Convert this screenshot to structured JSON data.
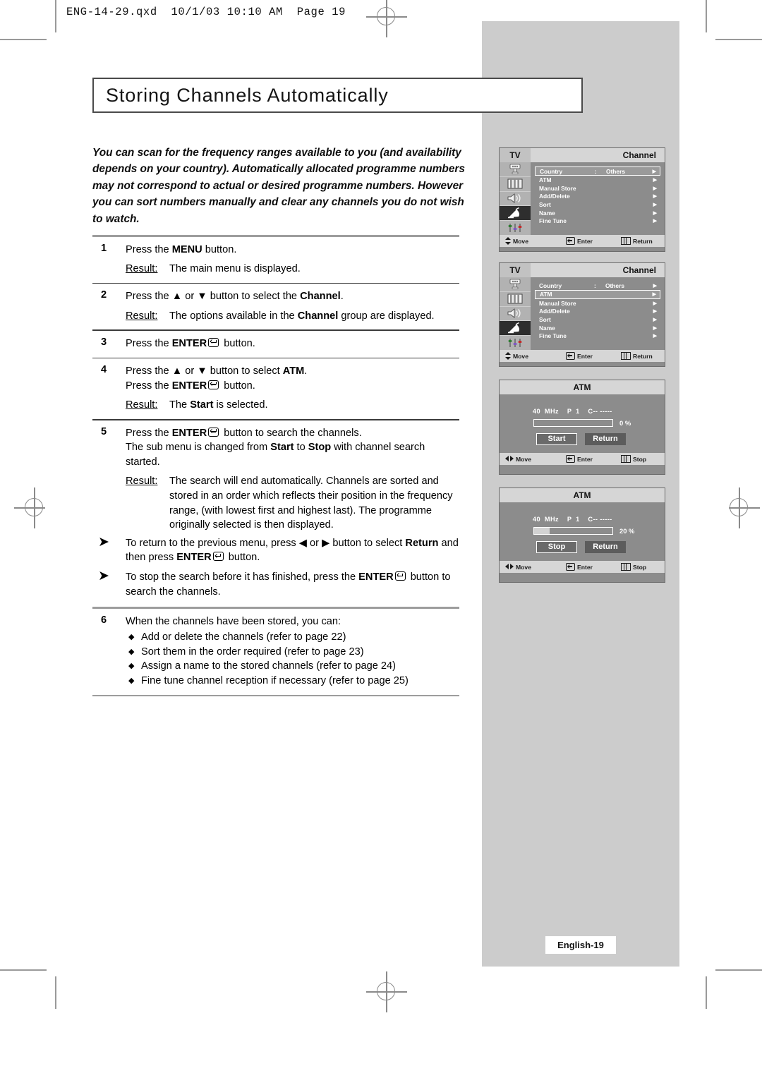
{
  "file_header": "ENG-14-29.qxd  10/1/03 10:10 AM  Page 19",
  "title": "Storing Channels Automatically",
  "intro": "You can scan for the frequency ranges available to you (and availability depends on your country). Automatically allocated programme numbers may not correspond to actual or desired programme numbers. However you can sort numbers manually and clear any channels you do not wish to watch.",
  "steps": {
    "s1": {
      "num": "1",
      "text_pre": "Press the ",
      "bold": "MENU",
      "text_post": " button.",
      "result_label": "Result:",
      "result_text": "The main menu is displayed."
    },
    "s2": {
      "num": "2",
      "text_pre": "Press the ▲ or ▼ button to select the ",
      "bold": "Channel",
      "text_post": ".",
      "result_label": "Result:",
      "result_pre": "The options available in the ",
      "result_bold": "Channel",
      "result_post": " group are displayed."
    },
    "s3": {
      "num": "3",
      "text_pre": "Press the ",
      "bold": "ENTER",
      "text_post": " button."
    },
    "s4": {
      "num": "4",
      "line1_pre": "Press the ▲ or ▼ button to select ",
      "line1_bold": "ATM",
      "line1_post": ".",
      "line2_pre": "Press the ",
      "line2_bold": "ENTER",
      "line2_post": " button.",
      "result_label": "Result:",
      "result_pre": "The ",
      "result_bold": "Start",
      "result_post": " is selected."
    },
    "s5": {
      "num": "5",
      "line1_pre": "Press the ",
      "line1_bold": "ENTER",
      "line1_post": " button to search the channels.",
      "line2_pre": "The sub menu is changed from ",
      "line2_bold1": "Start",
      "line2_mid": " to ",
      "line2_bold2": "Stop",
      "line2_post": " with channel search started.",
      "result_label": "Result:",
      "result_text": "The search will end automatically. Channels are sorted and stored in an order which reflects their position in the frequency range, (with lowest first and highest last). The programme originally selected is then displayed."
    },
    "s6": {
      "num": "6",
      "text": "When the channels have been stored, you can:",
      "bullets": [
        "Add or delete the channels (refer to page 22)",
        "Sort them in the order required (refer to page 23)",
        "Assign a name to the stored channels (refer to page 24)",
        "Fine tune channel reception if necessary (refer to page 25)"
      ]
    }
  },
  "notes": [
    {
      "pre": "To return to the previous menu, press ◀ or ▶ button to select ",
      "bold1": "Return",
      "mid": " and then press ",
      "bold2": "ENTER",
      "post": " button."
    },
    {
      "pre": "To stop the search before it has finished, press the ",
      "bold1": "ENTER",
      "post": " button to search the channels."
    }
  ],
  "osd": {
    "tv_label": "TV",
    "group_label": "Channel",
    "menu_items": [
      {
        "label": "Country",
        "colon": ":",
        "value": "Others",
        "arrow": "▶"
      },
      {
        "label": "ATM",
        "colon": "",
        "value": "",
        "arrow": "▶"
      },
      {
        "label": "Manual Store",
        "colon": "",
        "value": "",
        "arrow": "▶"
      },
      {
        "label": "Add/Delete",
        "colon": "",
        "value": "",
        "arrow": "▶"
      },
      {
        "label": "Sort",
        "colon": "",
        "value": "",
        "arrow": "▶"
      },
      {
        "label": "Name",
        "colon": "",
        "value": "",
        "arrow": "▶"
      },
      {
        "label": "Fine Tune",
        "colon": "",
        "value": "",
        "arrow": "▶"
      }
    ],
    "panel1_selected_index": 0,
    "panel2_selected_index": 1,
    "footer": {
      "move": "Move",
      "enter": "Enter",
      "return": "Return",
      "stop": "Stop"
    }
  },
  "atm1": {
    "title": "ATM",
    "freq": "40  MHz    P  1    C-- -----",
    "percent_label": "0  %",
    "percent_value": 0,
    "btn_primary": "Start",
    "btn_secondary": "Return",
    "footer_move": "Move",
    "footer_enter": "Enter",
    "footer_stop": "Stop"
  },
  "atm2": {
    "title": "ATM",
    "freq": "40  MHz    P  1    C-- -----",
    "percent_label": "20  %",
    "percent_value": 20,
    "btn_primary": "Stop",
    "btn_secondary": "Return",
    "footer_move": "Move",
    "footer_enter": "Enter",
    "footer_stop": "Stop"
  },
  "page_badge": "English-19",
  "colors": {
    "panel_gray": "#cccccc",
    "osd_body": "#8c8c8c",
    "osd_bar": "#d6d6d6",
    "rule": "#9d9d9d"
  }
}
